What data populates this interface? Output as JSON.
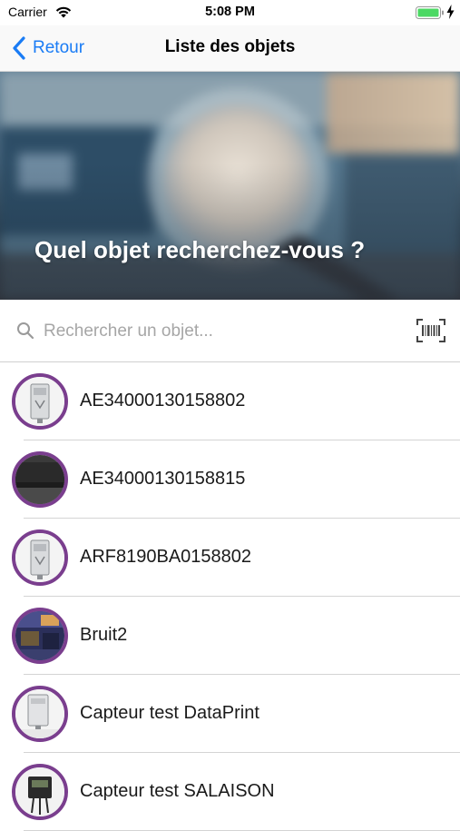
{
  "status_bar": {
    "carrier": "Carrier",
    "time": "5:08 PM"
  },
  "nav": {
    "back_label": "Retour",
    "title": "Liste des objets"
  },
  "hero": {
    "title": "Quel objet recherchez-vous ?"
  },
  "search": {
    "placeholder": "Rechercher un objet...",
    "value": ""
  },
  "objects": [
    {
      "name": "AE34000130158802",
      "icon": "sensor-box-icon"
    },
    {
      "name": "AE34000130158815",
      "icon": "dark-device-icon"
    },
    {
      "name": "ARF8190BA0158802",
      "icon": "sensor-box-icon"
    },
    {
      "name": "Bruit2",
      "icon": "room-photo-icon"
    },
    {
      "name": "Capteur test DataPrint",
      "icon": "sensor-box-icon"
    },
    {
      "name": "Capteur test SALAISON",
      "icon": "probe-device-icon"
    }
  ],
  "colors": {
    "accent": "#1a7cf5",
    "thumb_ring": "#7a3e8e",
    "battery": "#4cd964"
  }
}
